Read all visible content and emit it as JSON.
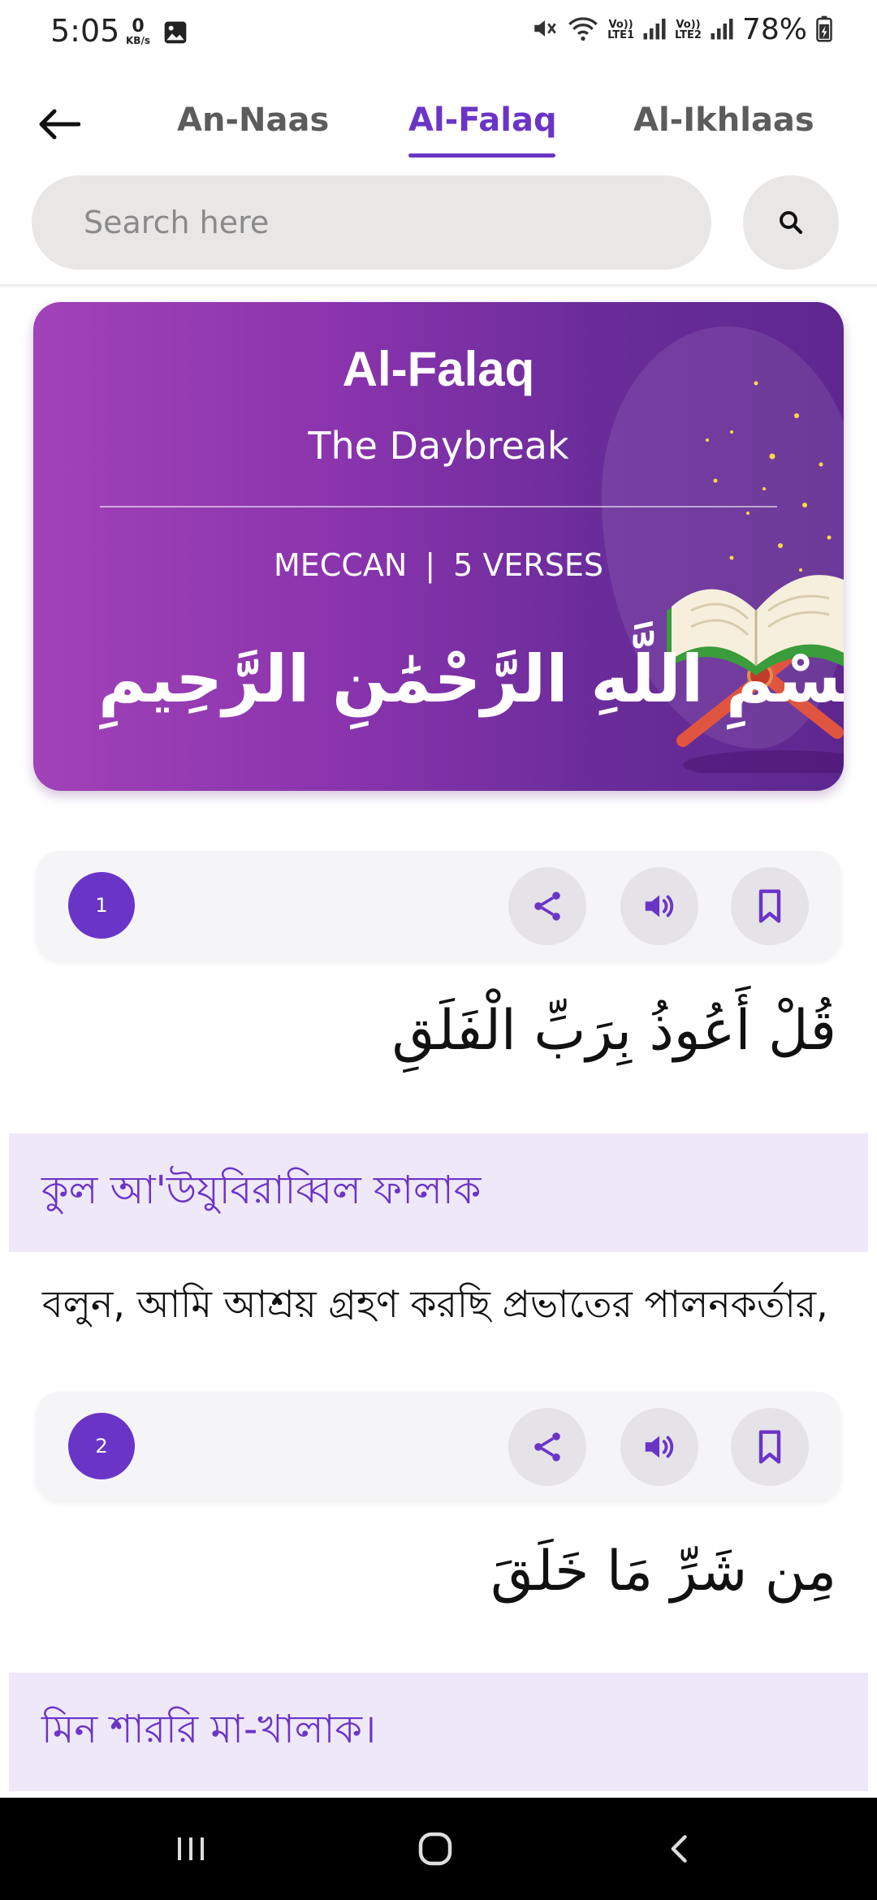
{
  "status_bar": {
    "time": "5:05",
    "net_speed_value": "0",
    "net_speed_unit": "KB/s",
    "volte1": "Vo))\nLTE1",
    "volte2": "Vo))\nLTE2",
    "battery": "78%"
  },
  "header": {
    "tabs": [
      {
        "label": "An-Naas"
      },
      {
        "label": "Al-Falaq"
      },
      {
        "label": "Al-Ikhlaas"
      }
    ],
    "active_tab": "Al-Falaq",
    "search_placeholder": "Search here"
  },
  "surah_card": {
    "name": "Al-Falaq",
    "meaning": "The Daybreak",
    "revelation": "MECCAN",
    "separator": "|",
    "verses_label": "5  VERSES",
    "bismillah": "بِسْمِ اللَّهِ الرَّحْمَٰنِ الرَّحِيمِ"
  },
  "verses": [
    {
      "number": "1",
      "arabic": "قُلْ أَعُوذُ بِرَبِّ الْفَلَقِ",
      "transliteration": "কুল আ'উযুবিরাব্বিল ফালাক",
      "translation": "বলুন, আমি আশ্রয় গ্রহণ করছি প্রভাতের পালনকর্তার,"
    },
    {
      "number": "2",
      "arabic": "مِن شَرِّ مَا خَلَقَ",
      "transliteration": "মিন শাররি মা-খালাক।",
      "translation": ""
    }
  ],
  "colors": {
    "accent": "#6a35c7",
    "card_start": "#a142b8",
    "card_end": "#5e2790",
    "translit_band": "#efe8f8",
    "action_bg": "#e5e3e8"
  },
  "icons": {
    "back": "arrow-left-icon",
    "search": "search-icon",
    "share": "share-icon",
    "audio": "volume-icon",
    "bookmark": "bookmark-icon"
  }
}
